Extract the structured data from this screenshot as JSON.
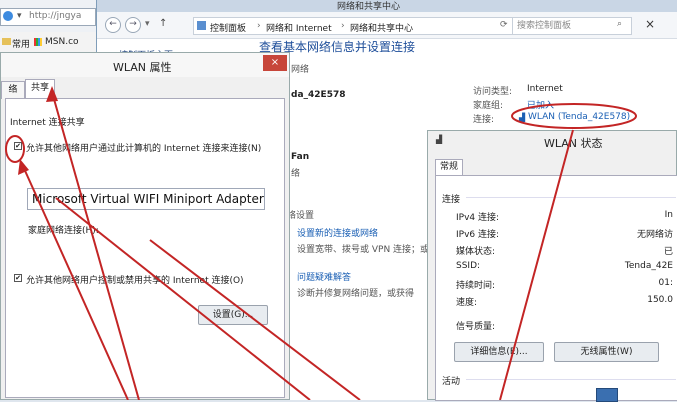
{
  "browser": {
    "address": "http://jngya",
    "favorites": [
      {
        "label": "常用"
      },
      {
        "label": "MSN.co"
      }
    ]
  },
  "control_panel": {
    "window_title": "网络和共享中心",
    "breadcrumb": [
      "控制面板",
      "网络和 Internet",
      "网络和共享中心"
    ],
    "search_placeholder": "搜索控制面板",
    "left_link": "控制面板主页",
    "heading": "查看基本网络信息并设置连接",
    "network_label": "网络",
    "network1_name": "da_42E578",
    "access_type_label": "访问类型:",
    "access_type_value": "Internet",
    "homegroup_label": "家庭组:",
    "homegroup_value": "已加入",
    "connection_label": "连接:",
    "connection_value": "WLAN (Tenda_42E578)",
    "network2_name": "Fan",
    "network2_sub": "络",
    "change_section": "络设置",
    "setup_link": "设置新的连接或网络",
    "setup_desc": "设置宽带、拨号或 VPN 连接；或",
    "troubleshoot_link": "问题疑难解答",
    "troubleshoot_desc": "诊断并修复网络问题，或获得"
  },
  "props_dialog": {
    "title": "WLAN 属性",
    "tab_network": "络",
    "tab_sharing": "共享",
    "group_label": "Internet 连接共享",
    "allow_share_label": "允许其他网络用户通过此计算机的 Internet 连接来连接(N)",
    "allow_share_checked": true,
    "home_conn_label": "家庭网络连接(H):",
    "home_conn_value": "Microsoft Virtual WIFI Miniport Adapter",
    "allow_control_label": "允许其他网络用户控制或禁用共享的 Internet 连接(O)",
    "allow_control_checked": true,
    "settings_button": "设置(G)...",
    "close_glyph": "×"
  },
  "status_dialog": {
    "title": "WLAN 状态",
    "tab_general": "常规",
    "section_connection": "连接",
    "rows": [
      {
        "label": "IPv4 连接:",
        "value": "In"
      },
      {
        "label": "IPv6 连接:",
        "value": "无网络访"
      },
      {
        "label": "媒体状态:",
        "value": "已"
      },
      {
        "label": "SSID:",
        "value": "Tenda_42E"
      },
      {
        "label": "持续时间:",
        "value": "01:"
      },
      {
        "label": "速度:",
        "value": "150.0"
      }
    ],
    "signal_label": "信号质量:",
    "details_button": "详细信息(E)...",
    "wireless_button": "无线属性(W)",
    "section_activity": "活动"
  }
}
